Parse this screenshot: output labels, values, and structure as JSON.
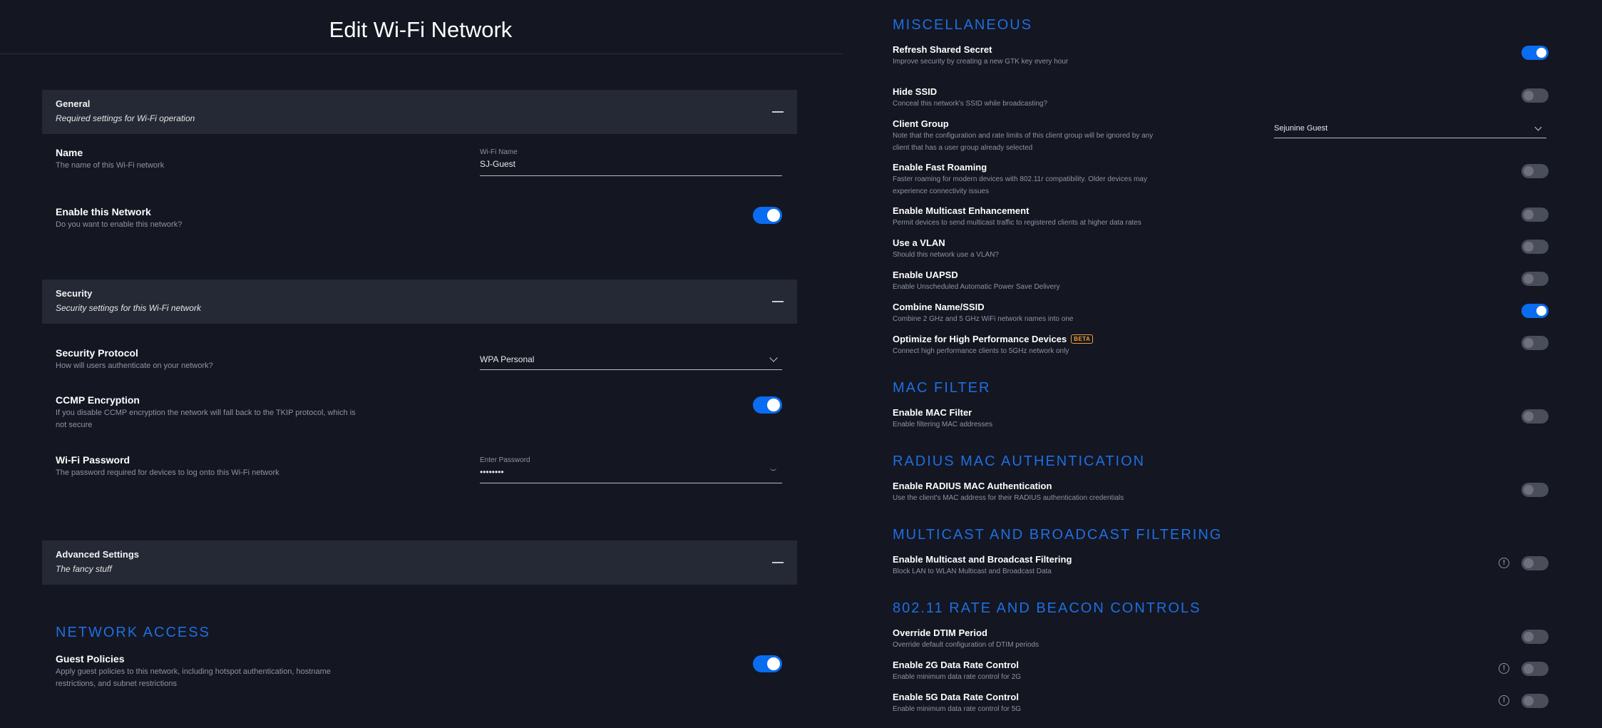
{
  "page": {
    "title": "Edit Wi-Fi Network"
  },
  "sections": {
    "general": {
      "title": "General",
      "subtitle": "Required settings for Wi-Fi operation"
    },
    "security": {
      "title": "Security",
      "subtitle": "Security settings for this Wi-Fi network"
    },
    "advanced": {
      "title": "Advanced Settings",
      "subtitle": "The fancy stuff"
    }
  },
  "name_row": {
    "label": "Name",
    "description": "The name of this Wi-Fi network",
    "field_label": "Wi-Fi Name",
    "value": "SJ-Guest"
  },
  "enable_network": {
    "label": "Enable this Network",
    "description": "Do you want to enable this network?",
    "enabled": true
  },
  "security_protocol": {
    "label": "Security Protocol",
    "description": "How will users authenticate on your network?",
    "value": "WPA Personal"
  },
  "ccmp": {
    "label": "CCMP Encryption",
    "description_1": "If you disable CCMP encryption the network will fall back to the TKIP protocol, which is",
    "description_2": "not secure",
    "enabled": true
  },
  "wifi_password": {
    "label": "Wi-Fi Password",
    "description": "The password required for devices to log onto this Wi-Fi network",
    "field_label": "Enter Password",
    "value": "••••••••"
  },
  "network_access": {
    "heading": "NETWORK ACCESS",
    "guest_policies": {
      "label": "Guest Policies",
      "description_1": "Apply guest policies to this network, including hotspot authentication, hostname",
      "description_2": "restrictions, and subnet restrictions",
      "enabled": true
    }
  },
  "misc": {
    "heading": "MISCELLANEOUS",
    "refresh_secret": {
      "label": "Refresh Shared Secret",
      "description": "Improve security by creating a new GTK key every hour",
      "enabled": true
    },
    "hide_ssid": {
      "label": "Hide SSID",
      "description": "Conceal this network's SSID while broadcasting?",
      "enabled": false
    },
    "client_group": {
      "label": "Client Group",
      "description_1": "Note that the configuration and rate limits of this client group will be ignored by any",
      "description_2": "client that has a user group already selected",
      "value": "Sejunine Guest"
    },
    "fast_roaming": {
      "label": "Enable Fast Roaming",
      "description_1": "Faster roaming for modern devices with 802.11r compatibility. Older devices may",
      "description_2": "experience connectivity issues",
      "enabled": false
    },
    "multicast_enhancement": {
      "label": "Enable Multicast Enhancement",
      "description": "Permit devices to send multicast traffic to registered clients at higher data rates",
      "enabled": false
    },
    "vlan": {
      "label": "Use a VLAN",
      "description": "Should this network use a VLAN?",
      "enabled": false
    },
    "uapsd": {
      "label": "Enable UAPSD",
      "description": "Enable Unscheduled Automatic Power Save Delivery",
      "enabled": false
    },
    "combine_ssid": {
      "label": "Combine Name/SSID",
      "description": "Combine 2 GHz and 5 GHz WiFi network names into one",
      "enabled": true
    },
    "high_perf": {
      "label": "Optimize for High Performance Devices",
      "badge": "BETA",
      "description": "Connect high performance clients to 5GHz network only",
      "enabled": false
    }
  },
  "mac_filter": {
    "heading": "MAC FILTER",
    "item": {
      "label": "Enable MAC Filter",
      "description": "Enable filtering MAC addresses",
      "enabled": false
    }
  },
  "radius": {
    "heading": "RADIUS MAC AUTHENTICATION",
    "item": {
      "label": "Enable RADIUS MAC Authentication",
      "description": "Use the client's MAC address for their RADIUS authentication credentials",
      "enabled": false
    }
  },
  "multicast_filtering": {
    "heading": "MULTICAST AND BROADCAST FILTERING",
    "item": {
      "label": "Enable Multicast and Broadcast Filtering",
      "description": "Block LAN to WLAN Multicast and Broadcast Data",
      "enabled": false
    }
  },
  "rate_beacon": {
    "heading": "802.11 RATE AND BEACON CONTROLS",
    "dtim": {
      "label": "Override DTIM Period",
      "description": "Override default configuration of DTIM periods",
      "enabled": false
    },
    "rate_2g": {
      "label": "Enable 2G Data Rate Control",
      "description": "Enable minimum data rate control for 2G",
      "enabled": false
    },
    "rate_5g": {
      "label": "Enable 5G Data Rate Control",
      "description": "Enable minimum data rate control for 5G",
      "enabled": false
    }
  },
  "icons": {
    "collapse": "minus-icon",
    "dropdown": "chevron-down-icon",
    "info": "info-icon",
    "accent": "#0a6cf0",
    "heading_color": "#1e6fe0"
  }
}
